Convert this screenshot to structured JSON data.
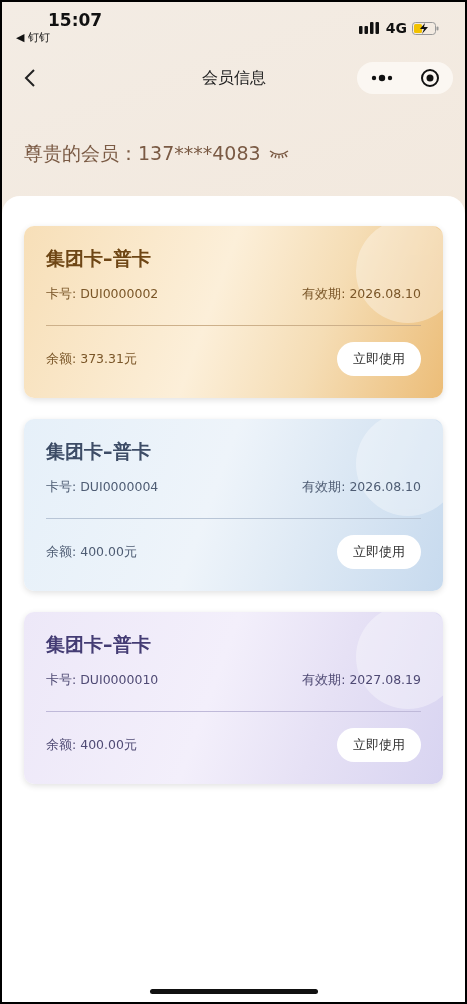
{
  "status_bar": {
    "time": "15:07",
    "back_app": "◀ 钉钉",
    "network": "4G"
  },
  "nav": {
    "title": "会员信息"
  },
  "member": {
    "label": "尊贵的会员：137****4083"
  },
  "cards": [
    {
      "kind": "gold",
      "title": "集团卡–普卡",
      "card_no": "卡号: DUI0000002",
      "expiry": "有效期: 2026.08.10",
      "balance": "余额: 373.31元",
      "button": "立即使用"
    },
    {
      "kind": "blue",
      "title": "集团卡–普卡",
      "card_no": "卡号: DUI0000004",
      "expiry": "有效期: 2026.08.10",
      "balance": "余额: 400.00元",
      "button": "立即使用"
    },
    {
      "kind": "purple",
      "title": "集团卡–普卡",
      "card_no": "卡号: DUI0000010",
      "expiry": "有效期: 2027.08.19",
      "balance": "余额: 400.00元",
      "button": "立即使用"
    }
  ]
}
